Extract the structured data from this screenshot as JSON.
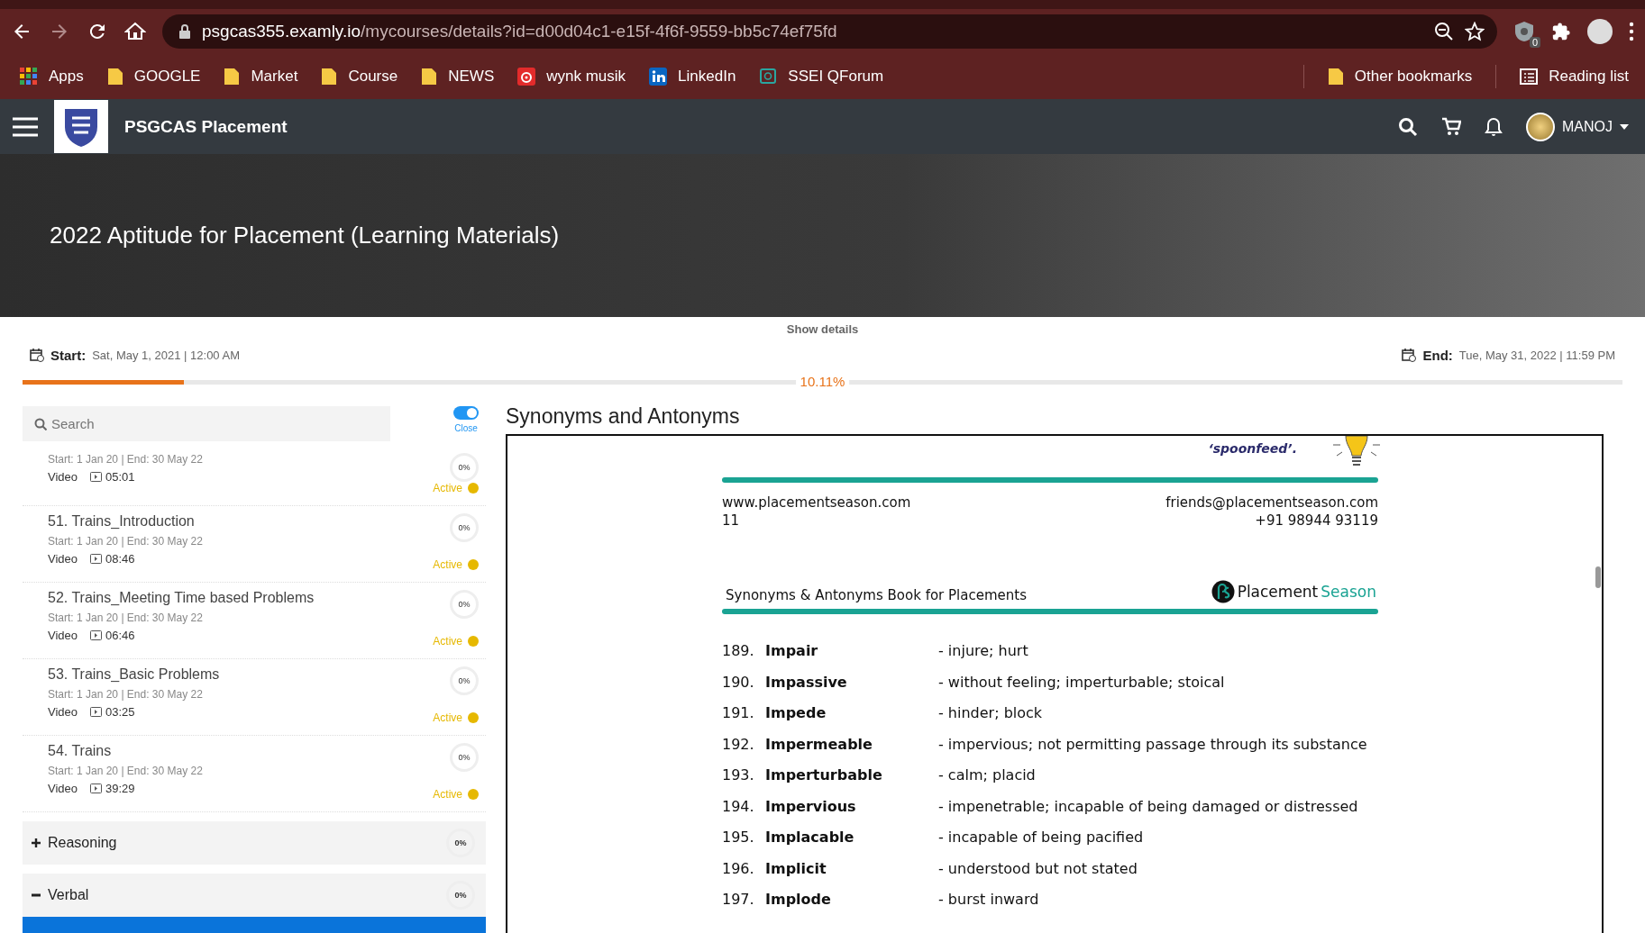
{
  "browser": {
    "url_host": "psgcas355.examly.io",
    "url_path": "/mycourses/details?id=d00d04c1-e15f-4f6f-9559-bb5c74ef75fd",
    "extension_badge": "0",
    "bookmarks": [
      {
        "label": "Apps",
        "kind": "apps"
      },
      {
        "label": "GOOGLE",
        "kind": "folder"
      },
      {
        "label": "Market",
        "kind": "folder"
      },
      {
        "label": "Course",
        "kind": "folder"
      },
      {
        "label": "NEWS",
        "kind": "folder"
      },
      {
        "label": "wynk musik",
        "kind": "music"
      },
      {
        "label": "LinkedIn",
        "kind": "linkedin"
      },
      {
        "label": "SSEI QForum",
        "kind": "forum"
      }
    ],
    "other_bookmarks": "Other bookmarks",
    "reading_list": "Reading list"
  },
  "app": {
    "title": "PSGCAS Placement",
    "user": "MANOJ"
  },
  "course": {
    "title": "2022 Aptitude for Placement (Learning Materials)",
    "show_details": "Show details",
    "start_label": "Start:",
    "start": "Sat, May 1, 2021 | 12:00 AM",
    "end_label": "End:",
    "end": "Tue, May 31, 2022 | 11:59 PM",
    "progress": {
      "level": 0.1011,
      "reading": "10.11%"
    }
  },
  "sidebar": {
    "search": {
      "placeholder": "Search"
    },
    "toggle": {
      "on": true,
      "label": "Close"
    },
    "lessons": [
      {
        "dates": "Start: 1 Jan 20 | End: 30 May 22",
        "type": "Video",
        "duration": "05:01",
        "progress": "0%",
        "status": "Active",
        "color": "#e6b800"
      },
      {
        "title": "51. Trains_Introduction",
        "dates": "Start: 1 Jan 20 | End: 30 May 22",
        "type": "Video",
        "duration": "08:46",
        "progress": "0%",
        "status": "Active",
        "color": "#e6b800"
      },
      {
        "title": "52. Trains_Meeting Time based Problems",
        "dates": "Start: 1 Jan 20 | End: 30 May 22",
        "type": "Video",
        "duration": "06:46",
        "progress": "0%",
        "status": "Active",
        "color": "#e6b800"
      },
      {
        "title": "53. Trains_Basic Problems",
        "dates": "Start: 1 Jan 20 | End: 30 May 22",
        "type": "Video",
        "duration": "03:25",
        "progress": "0%",
        "status": "Active",
        "color": "#e6b800"
      },
      {
        "title": "54. Trains",
        "dates": "Start: 1 Jan 20 | End: 30 May 22",
        "type": "Video",
        "duration": "39:29",
        "progress": "0%",
        "status": "Active",
        "color": "#e6b800"
      }
    ],
    "sections": [
      {
        "label": "Reasoning",
        "expanded": false,
        "progress": "0%"
      },
      {
        "label": "Verbal",
        "expanded": true,
        "progress": "0%"
      }
    ],
    "current_lesson": {
      "selected": true
    }
  },
  "document": {
    "title": "Synonyms and Antonyms",
    "quote_end": "‘spoonfeed’.",
    "website": "www.placementseason.com",
    "email": "friends@placementseason.com",
    "page_number": "11",
    "phone": "+91 98944 93119",
    "header_title": "Synonyms & Antonyms Book for Placements",
    "brand": "Placement",
    "brand_accent": "Season",
    "entries": [
      {
        "number": "189.",
        "word": "Impair",
        "meaning": "- injure; hurt"
      },
      {
        "number": "190.",
        "word": "Impassive",
        "meaning": "- without feeling; imperturbable; stoical"
      },
      {
        "number": "191.",
        "word": "Impede",
        "meaning": "- hinder; block"
      },
      {
        "number": "192.",
        "word": "Impermeable",
        "meaning": "- impervious; not permitting passage through its substance"
      },
      {
        "number": "193.",
        "word": "Imperturbable",
        "meaning": "- calm; placid"
      },
      {
        "number": "194.",
        "word": "Impervious",
        "meaning": "- impenetrable; incapable of being damaged or distressed"
      },
      {
        "number": "195.",
        "word": "Implacable",
        "meaning": "- incapable of being pacified"
      },
      {
        "number": "196.",
        "word": "Implicit",
        "meaning": "- understood but not stated"
      },
      {
        "number": "197.",
        "word": "Implode",
        "meaning": "- burst inward"
      }
    ]
  }
}
